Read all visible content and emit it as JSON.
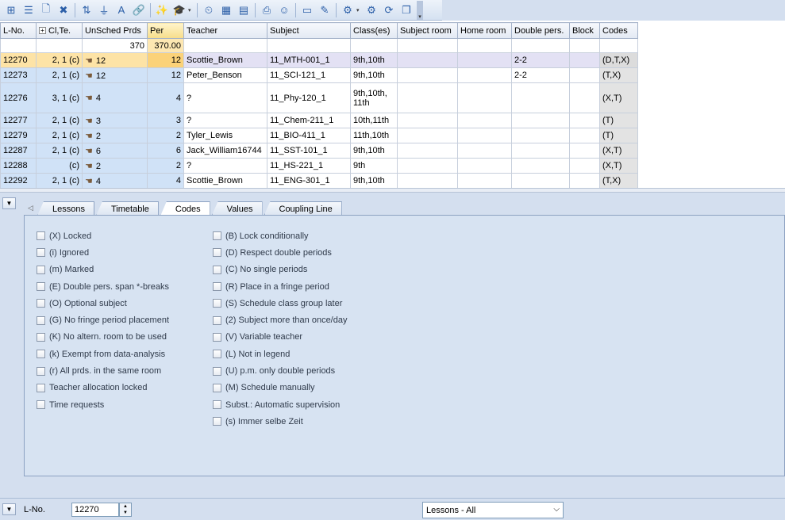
{
  "toolbar": {
    "buttons": [
      {
        "name": "new-lesson-icon",
        "glyph": "⊞"
      },
      {
        "name": "list-view-icon",
        "glyph": "☰"
      },
      {
        "name": "new-document-icon",
        "glyph": "🗋"
      },
      {
        "name": "delete-icon",
        "glyph": "✖"
      },
      {
        "name": "sort-icon",
        "glyph": "⇅"
      },
      {
        "name": "filter-icon",
        "glyph": "⏚"
      },
      {
        "name": "text-sort-icon",
        "glyph": "A"
      },
      {
        "name": "link-icon",
        "glyph": "🔗"
      },
      {
        "name": "wand-icon",
        "glyph": "✨"
      },
      {
        "name": "graduation-cap-icon",
        "glyph": "🎓"
      },
      {
        "name": "clock-icon",
        "glyph": "⏲"
      },
      {
        "name": "timetable-icon",
        "glyph": "▦"
      },
      {
        "name": "matrix-icon",
        "glyph": "▤"
      },
      {
        "name": "print-preview-icon",
        "glyph": "⎙"
      },
      {
        "name": "teacher-icon",
        "glyph": "☺"
      },
      {
        "name": "screen-icon",
        "glyph": "▭"
      },
      {
        "name": "edit-icon",
        "glyph": "✎"
      },
      {
        "name": "settings-dropdown-icon",
        "glyph": "⚙"
      },
      {
        "name": "gear-icon",
        "glyph": "⚙"
      },
      {
        "name": "refresh-icon",
        "glyph": "⟳"
      },
      {
        "name": "copy-icon",
        "glyph": "❐"
      }
    ]
  },
  "grid": {
    "headers": [
      "L-No.",
      "Cl,Te.",
      "UnSched Prds",
      "Per",
      "Teacher",
      "Subject",
      "Class(es)",
      "Subject room",
      "Home room",
      "Double pers.",
      "Block",
      "Codes"
    ],
    "summary": {
      "unsched": "370",
      "per": "370.00"
    },
    "rows": [
      {
        "lno": "12270",
        "clte": "2, 1 (c)",
        "uns": "12",
        "per": "12",
        "teacher": "Scottie_Brown",
        "subject": "11_MTH-001_1",
        "classes": "9th,10th",
        "sroom": "",
        "hroom": "",
        "double": "2-2",
        "block": "",
        "codes": "(D,T,X)"
      },
      {
        "lno": "12273",
        "clte": "2, 1 (c)",
        "uns": "12",
        "per": "12",
        "teacher": "Peter_Benson",
        "subject": "11_SCI-121_1",
        "classes": "9th,10th",
        "sroom": "",
        "hroom": "",
        "double": "2-2",
        "block": "",
        "codes": "(T,X)"
      },
      {
        "lno": "12276",
        "clte": "3, 1 (c)",
        "uns": "4",
        "per": "4",
        "teacher": "?",
        "subject": "11_Phy-120_1",
        "classes": "9th,10th, 11th",
        "sroom": "",
        "hroom": "",
        "double": "",
        "block": "",
        "codes": "(X,T)"
      },
      {
        "lno": "12277",
        "clte": "2, 1 (c)",
        "uns": "3",
        "per": "3",
        "teacher": "?",
        "subject": "11_Chem-211_1",
        "classes": "10th,11th",
        "sroom": "",
        "hroom": "",
        "double": "",
        "block": "",
        "codes": "(T)"
      },
      {
        "lno": "12279",
        "clte": "2, 1 (c)",
        "uns": "2",
        "per": "2",
        "teacher": "Tyler_Lewis",
        "subject": "11_BIO-411_1",
        "classes": "11th,10th",
        "sroom": "",
        "hroom": "",
        "double": "",
        "block": "",
        "codes": "(T)"
      },
      {
        "lno": "12287",
        "clte": "2, 1 (c)",
        "uns": "6",
        "per": "6",
        "teacher": "Jack_William16744",
        "subject": "11_SST-101_1",
        "classes": "9th,10th",
        "sroom": "",
        "hroom": "",
        "double": "",
        "block": "",
        "codes": "(X,T)"
      },
      {
        "lno": "12288",
        "clte": "(c)",
        "uns": "2",
        "per": "2",
        "teacher": "?",
        "subject": "11_HS-221_1",
        "classes": "9th",
        "sroom": "",
        "hroom": "",
        "double": "",
        "block": "",
        "codes": "(X,T)"
      },
      {
        "lno": "12292",
        "clte": "2, 1 (c)",
        "uns": "4",
        "per": "4",
        "teacher": "Scottie_Brown",
        "subject": "11_ENG-301_1",
        "classes": "9th,10th",
        "sroom": "",
        "hroom": "",
        "double": "",
        "block": "",
        "codes": "(T,X)"
      }
    ]
  },
  "tabs": [
    "Lessons",
    "Timetable",
    "Codes",
    "Values",
    "Coupling Line"
  ],
  "active_tab": "Codes",
  "codes_left": [
    "(X) Locked",
    "(i) Ignored",
    "(m) Marked",
    "(E) Double pers. span *-breaks",
    "(O) Optional subject",
    "(G) No fringe period placement",
    "(K) No altern. room to be used",
    "(k) Exempt from data-analysis",
    "(r) All prds. in the same room",
    "Teacher allocation locked",
    "Time requests"
  ],
  "codes_right": [
    "(B) Lock conditionally",
    "(D) Respect double periods",
    "(C) No single periods",
    "(R) Place in a fringe period",
    "(S) Schedule class group later",
    "(2) Subject more than once/day",
    "(V) Variable teacher",
    "(L) Not in legend",
    "(U) p.m. only double periods",
    "(M) Schedule manually",
    "Subst.: Automatic supervision",
    "(s) Immer selbe Zeit"
  ],
  "statusbar": {
    "label": "L-No.",
    "value": "12270",
    "view_select": "Lessons - All"
  }
}
